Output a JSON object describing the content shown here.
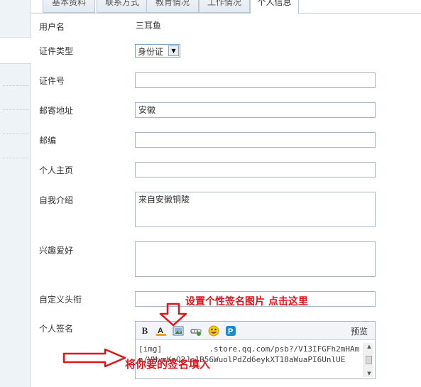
{
  "tabs": [
    "基本资料",
    "联系方式",
    "教育情况",
    "工作情况",
    "个人信息"
  ],
  "active_tab": "个人信息",
  "form": {
    "username_label": "用户名",
    "username_value": "三耳鱼",
    "id_type_label": "证件类型",
    "id_type_value": "身份证",
    "id_number_label": "证件号",
    "id_number_value": "",
    "address_label": "邮寄地址",
    "address_value": "安徽",
    "zipcode_label": "邮编",
    "zipcode_value": "",
    "homepage_label": "个人主页",
    "homepage_value": "",
    "intro_label": "自我介绍",
    "intro_value": "来自安徽铜陵",
    "hobby_label": "兴趣爱好",
    "hobby_value": "",
    "title_label": "自定义头衔",
    "title_value": "",
    "signature_label": "个人签名"
  },
  "editor": {
    "preview_label": "预览",
    "content": "[img]          .store.qq.com/psb?/V13IFGFh2mHAm\nn/VMwmKnQ2Je1B56WuolPdZd6eykXT18aWuaPI6UnlUE"
  },
  "annotations": {
    "top": "设置个性签名图片  点击这里",
    "bottom": "将你要的签名填入"
  },
  "colors": {
    "annotation": "#e0141c",
    "border": "#a9b6c3"
  }
}
